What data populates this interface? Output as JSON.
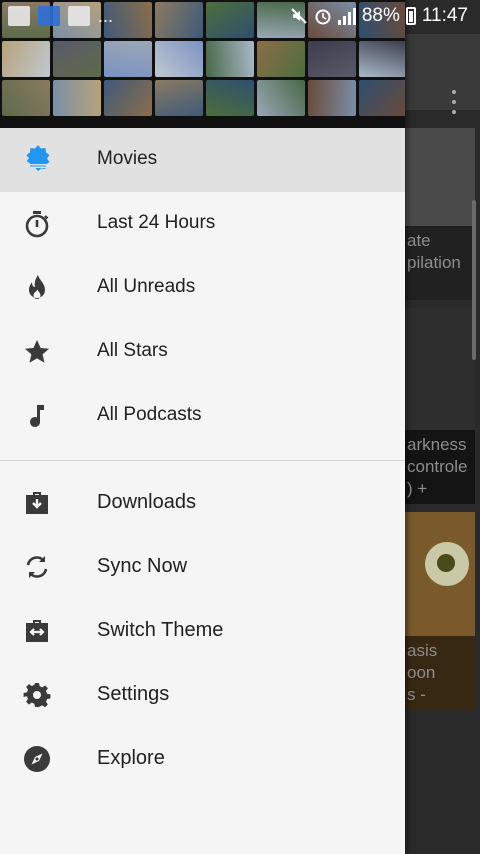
{
  "status_bar": {
    "battery": "88%",
    "time": "11:47",
    "overflow_dots": "..."
  },
  "background": {
    "card_captions": [
      "ate\npilation",
      "arkness\ncontrole\n) +",
      "asis\noon\ns -",
      ""
    ]
  },
  "drawer": {
    "items": [
      {
        "label": "Movies",
        "icon": "movies-logo-icon",
        "active": true
      },
      {
        "label": "Last 24 Hours",
        "icon": "stopwatch-icon"
      },
      {
        "label": "All Unreads",
        "icon": "flame-icon"
      },
      {
        "label": "All Stars",
        "icon": "star-icon"
      },
      {
        "label": "All Podcasts",
        "icon": "music-note-icon"
      }
    ],
    "actions": [
      {
        "label": "Downloads",
        "icon": "download-briefcase-icon"
      },
      {
        "label": "Sync Now",
        "icon": "sync-icon"
      },
      {
        "label": "Switch Theme",
        "icon": "switch-theme-icon"
      },
      {
        "label": "Settings",
        "icon": "gear-icon"
      },
      {
        "label": "Explore",
        "icon": "compass-icon"
      }
    ]
  },
  "colors": {
    "drawer_bg": "#f5f5f5",
    "active_bg": "#e1e1e1",
    "icon": "#3a3a3a",
    "accent": "#2196f3"
  }
}
